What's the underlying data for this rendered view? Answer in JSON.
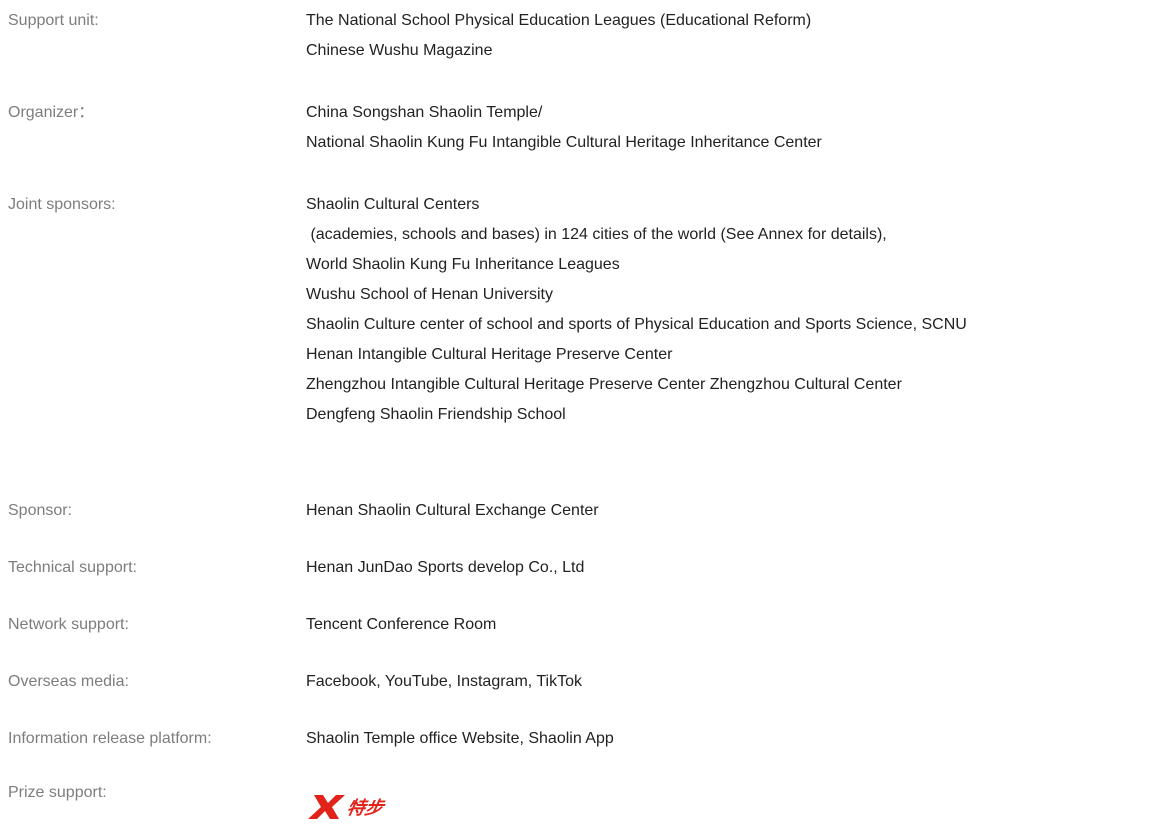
{
  "rows": [
    {
      "label": "Support unit:",
      "values": [
        "The National School Physical Education Leagues (Educational Reform)",
        "Chinese Wushu Magazine"
      ]
    },
    {
      "label": "Organizer：",
      "values": [
        "China Songshan Shaolin Temple/",
        "National Shaolin Kung Fu Intangible Cultural Heritage Inheritance Center"
      ]
    },
    {
      "label": "Joint sponsors:",
      "values": [
        "Shaolin Cultural Centers",
        " (academies, schools and bases) in 124 cities of the world (See Annex for details),",
        "World Shaolin Kung Fu Inheritance Leagues",
        "Wushu School of Henan University",
        "Shaolin Culture center of school and sports of Physical Education and Sports Science, SCNU",
        "Henan Intangible Cultural Heritage Preserve Center",
        "Zhengzhou Intangible Cultural Heritage Preserve Center Zhengzhou Cultural Center",
        "Dengfeng Shaolin Friendship School"
      ]
    },
    {
      "label": "Sponsor:",
      "values": [
        "Henan Shaolin Cultural Exchange Center"
      ]
    },
    {
      "label": "Technical support:",
      "values": [
        "Henan JunDao Sports develop Co., Ltd"
      ]
    },
    {
      "label": "Network support:",
      "values": [
        "Tencent Conference Room"
      ]
    },
    {
      "label": "Overseas media:",
      "values": [
        "Facebook, YouTube, Instagram, TikTok"
      ]
    },
    {
      "label": "Information release platform:",
      "values": [
        "Shaolin Temple office Website, Shaolin App"
      ]
    },
    {
      "label": "Prize support:"
    }
  ],
  "prize_logo": {
    "text": "特步",
    "icon": "xtep-logo-icon",
    "color": "#e2231a"
  }
}
